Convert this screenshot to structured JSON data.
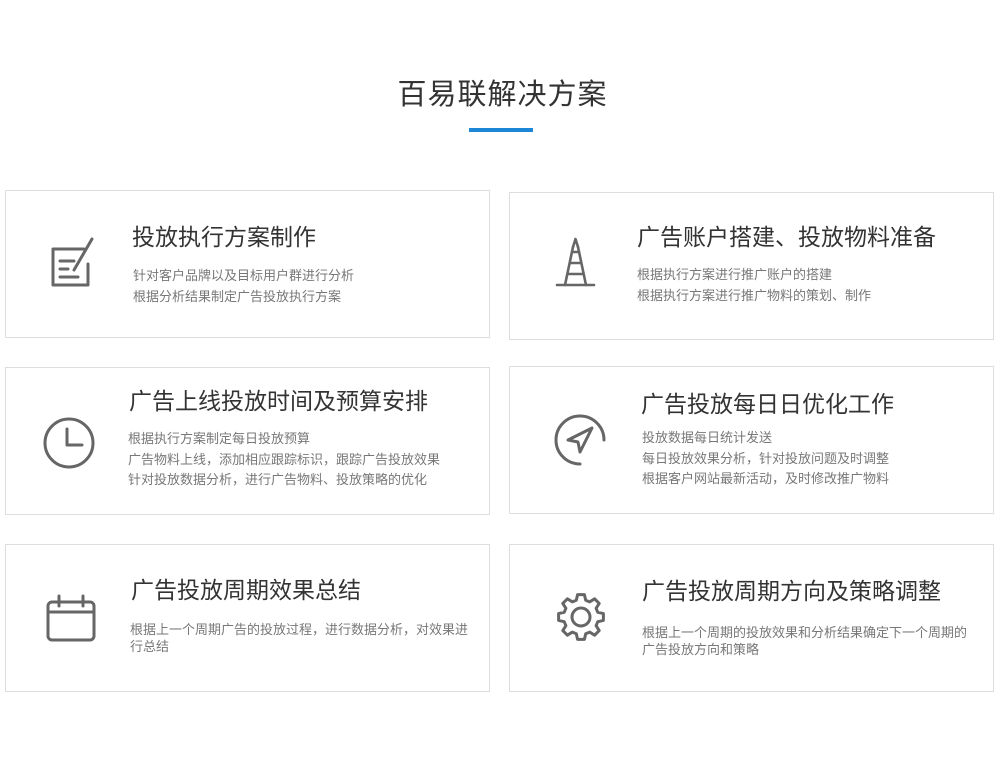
{
  "page": {
    "title": "百易联解决方案",
    "accent_color": "#1e86d6"
  },
  "cards": [
    {
      "icon": "edit-icon",
      "title": "投放执行方案制作",
      "lines": [
        "针对客户品牌以及目标用户群进行分析",
        "根据分析结果制定广告投放执行方案"
      ]
    },
    {
      "icon": "tower-icon",
      "title": "广告账户搭建、投放物料准备",
      "lines": [
        "根据执行方案进行推广账户的搭建",
        "根据执行方案进行推广物料的策划、制作"
      ]
    },
    {
      "icon": "clock-icon",
      "title": "广告上线投放时间及预算安排",
      "lines": [
        "根据执行方案制定每日投放预算",
        "广告物料上线，添加相应跟踪标识，跟踪广告投放效果",
        "针对投放数据分析，进行广告物料、投放策略的优化"
      ]
    },
    {
      "icon": "navigation-icon",
      "title": "广告投放每日日优化工作",
      "lines": [
        "投放数据每日统计发送",
        "每日投放效果分析，针对投放问题及时调整",
        "根据客户网站最新活动，及时修改推广物料"
      ]
    },
    {
      "icon": "calendar-icon",
      "title": "广告投放周期效果总结",
      "text": "根据上一个周期广告的投放过程，进行数据分析，对效果进行总结"
    },
    {
      "icon": "gear-icon",
      "title": "广告投放周期方向及策略调整",
      "text": "根据上一个周期的投放效果和分析结果确定下一个周期的广告投放方向和策略"
    }
  ]
}
